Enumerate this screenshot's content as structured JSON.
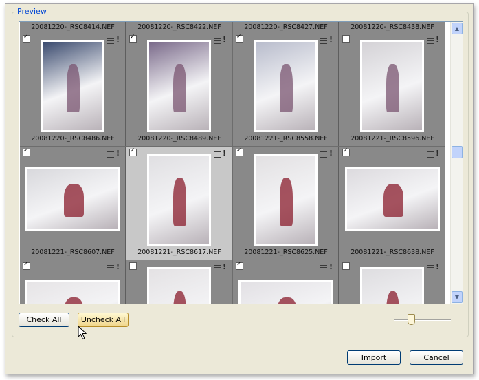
{
  "group_title": "Preview",
  "grid": {
    "top_partial_labels": [
      "20081220-_RSC8414.NEF",
      "20081220-_RSC8422.NEF",
      "20081220-_RSC8427.NEF",
      "20081220-_RSC8438.NEF"
    ],
    "rows": [
      [
        {
          "name": "20081220-_RSC8486.NEF",
          "checked": true,
          "selected": false
        },
        {
          "name": "20081220-_RSC8489.NEF",
          "checked": true,
          "selected": false
        },
        {
          "name": "20081221-_RSC8558.NEF",
          "checked": true,
          "selected": false
        },
        {
          "name": "20081221-_RSC8596.NEF",
          "checked": false,
          "selected": false
        }
      ],
      [
        {
          "name": "20081221-_RSC8607.NEF",
          "checked": true,
          "selected": false
        },
        {
          "name": "20081221-_RSC8617.NEF",
          "checked": true,
          "selected": true
        },
        {
          "name": "20081221-_RSC8625.NEF",
          "checked": true,
          "selected": false
        },
        {
          "name": "20081221-_RSC8638.NEF",
          "checked": true,
          "selected": false
        }
      ],
      [
        {
          "name": "",
          "checked": true,
          "selected": false
        },
        {
          "name": "",
          "checked": false,
          "selected": false
        },
        {
          "name": "",
          "checked": true,
          "selected": false
        },
        {
          "name": "",
          "checked": false,
          "selected": false
        }
      ]
    ]
  },
  "buttons": {
    "check_all": "Check All",
    "uncheck_all": "Uncheck All",
    "import": "Import",
    "cancel": "Cancel"
  },
  "scrollbar": {
    "up": "▲",
    "down": "▼"
  },
  "icons": {
    "cell_menu": "lines-icon",
    "cell_flag": "exclamation-icon",
    "cursor": "arrow-cursor-icon"
  },
  "zoom_slider_level": 0.3
}
